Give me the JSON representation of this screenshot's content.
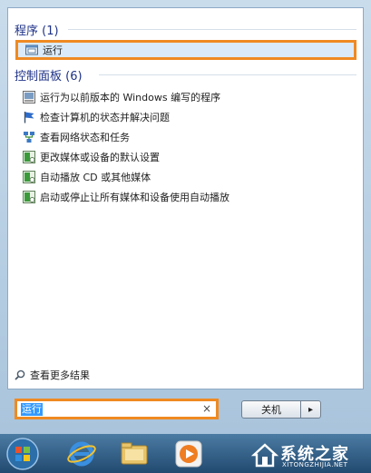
{
  "programs": {
    "header": "程序 (1)",
    "items": [
      {
        "label": "运行",
        "icon": "run-icon"
      }
    ]
  },
  "control_panel": {
    "header": "控制面板 (6)",
    "items": [
      {
        "label": "运行为以前版本的 Windows 编写的程序",
        "icon": "compatibility-icon"
      },
      {
        "label": "检查计算机的状态并解决问题",
        "icon": "action-center-flag-icon"
      },
      {
        "label": "查看网络状态和任务",
        "icon": "network-icon"
      },
      {
        "label": "更改媒体或设备的默认设置",
        "icon": "autoplay-icon"
      },
      {
        "label": "自动播放 CD 或其他媒体",
        "icon": "autoplay-icon"
      },
      {
        "label": "启动或停止让所有媒体和设备使用自动播放",
        "icon": "autoplay-icon"
      }
    ]
  },
  "more_results": "查看更多结果",
  "search": {
    "value": "运行",
    "clear": "×"
  },
  "shutdown": {
    "label": "关机",
    "arrow": "▸"
  },
  "watermark": {
    "cn": "系统之家",
    "en": "XITONGZHIJIA.NET"
  },
  "colors": {
    "highlight_border": "#ef8a22",
    "header_text": "#1e3287",
    "selection": "#3399ff"
  }
}
